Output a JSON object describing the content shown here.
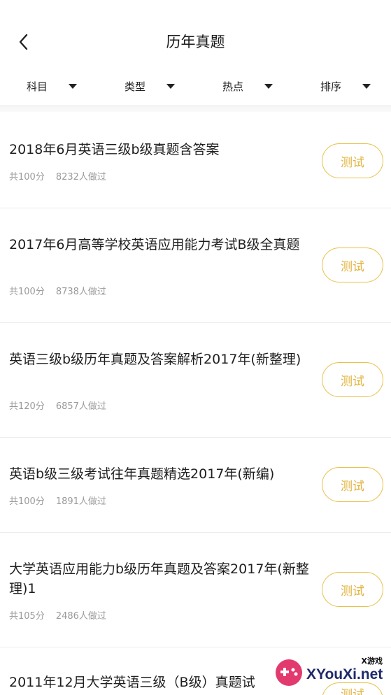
{
  "header": {
    "title": "历年真题"
  },
  "filters": [
    {
      "label": "科目"
    },
    {
      "label": "类型"
    },
    {
      "label": "热点"
    },
    {
      "label": "排序"
    }
  ],
  "items": [
    {
      "title": "2018年6月英语三级b级真题含答案",
      "score": "共100分",
      "count": "8232人做过",
      "action": "测试"
    },
    {
      "title": "2017年6月高等学校英语应用能力考试B级全真题",
      "score": "共100分",
      "count": "8738人做过",
      "action": "测试"
    },
    {
      "title": "英语三级b级历年真题及答案解析2017年(新整理)",
      "score": "共120分",
      "count": "6857人做过",
      "action": "测试"
    },
    {
      "title": "英语b级三级考试往年真题精选2017年(新编)",
      "score": "共100分",
      "count": "1891人做过",
      "action": "测试"
    },
    {
      "title": "大学英语应用能力b级历年真题及答案2017年(新整理)1",
      "score": "共105分",
      "count": "2486人做过",
      "action": "测试"
    },
    {
      "title": "2011年12月大学英语三级（B级）真题试",
      "score": "",
      "count": "",
      "action": "测试"
    }
  ],
  "watermark": {
    "small": "X游戏",
    "text": "XYouXi.net"
  }
}
